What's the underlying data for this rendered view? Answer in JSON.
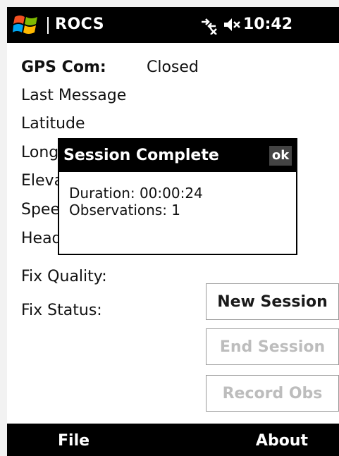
{
  "title_bar": {
    "app_title": "ROCS",
    "time": "10:42",
    "icons": [
      "windows-start-icon",
      "connectivity-off-icon",
      "speaker-muted-icon"
    ]
  },
  "fields": [
    {
      "label": "GPS Com:",
      "value": "Closed"
    },
    {
      "label": "Last Message",
      "value": ""
    },
    {
      "label": "Latitude",
      "value": ""
    },
    {
      "label": "Long",
      "value": ""
    },
    {
      "label": "Eleva",
      "value": ""
    },
    {
      "label": "Spee",
      "value": ""
    },
    {
      "label": "Head",
      "value": ""
    },
    {
      "label": "Fix Quality:",
      "value": ""
    },
    {
      "label": "Fix Status:",
      "value": ""
    }
  ],
  "buttons": {
    "new_session": "New Session",
    "end_session": "End Session",
    "record_obs": "Record Obs"
  },
  "dialog": {
    "title": "Session Complete",
    "ok": "ok",
    "duration": "Duration: 00:00:24",
    "observations": "Observations: 1"
  },
  "menu": {
    "left": "File",
    "right": "About"
  },
  "colors": {
    "bar": "#000000",
    "disabled_text": "#bdbdbd"
  }
}
